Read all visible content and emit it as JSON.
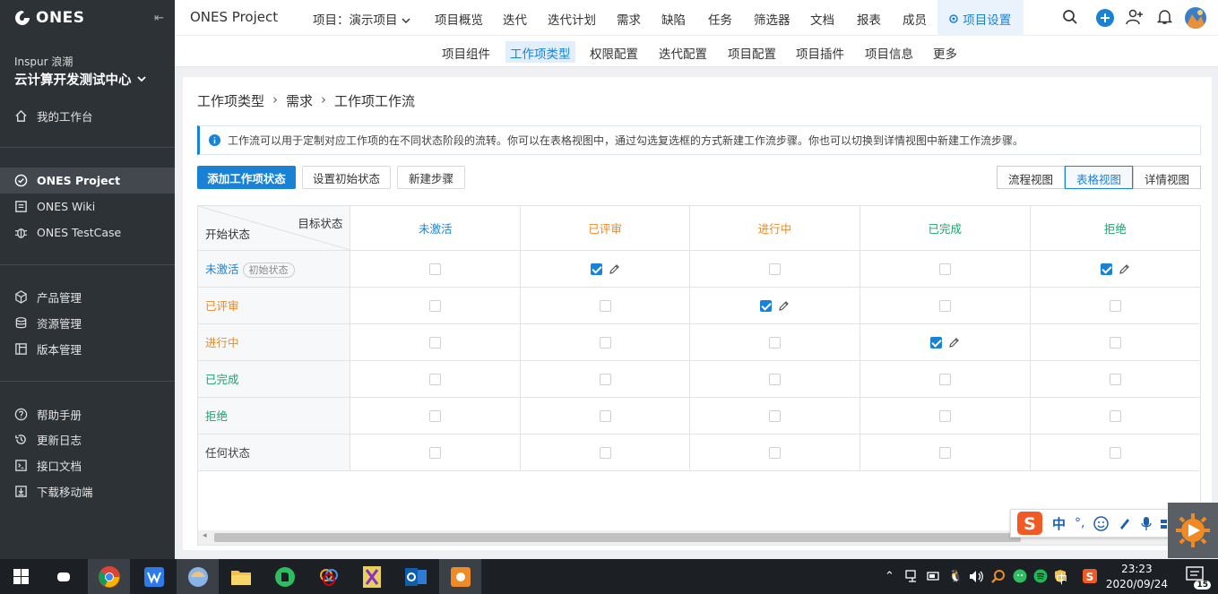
{
  "sidebar": {
    "logo": "ONES",
    "org": "Inspur 浪潮",
    "team": "云计算开发测试中心",
    "items": [
      {
        "label": "我的工作台",
        "icon": "home-icon"
      },
      {
        "label": "ONES Project",
        "icon": "check-circle-icon"
      },
      {
        "label": "ONES Wiki",
        "icon": "document-icon"
      },
      {
        "label": "ONES TestCase",
        "icon": "bug-icon"
      },
      {
        "label": "产品管理",
        "icon": "cube-icon"
      },
      {
        "label": "资源管理",
        "icon": "database-icon"
      },
      {
        "label": "版本管理",
        "icon": "version-icon"
      },
      {
        "label": "帮助手册",
        "icon": "help-icon"
      },
      {
        "label": "更新日志",
        "icon": "history-icon"
      },
      {
        "label": "接口文档",
        "icon": "terminal-icon"
      },
      {
        "label": "下载移动端",
        "icon": "download-icon"
      }
    ]
  },
  "topbar": {
    "project_title": "ONES Project",
    "project_selector": "项目：演示项目",
    "nav": [
      "项目概览",
      "迭代",
      "迭代计划",
      "需求",
      "缺陷",
      "任务",
      "筛选器",
      "文档",
      "报表",
      "成员"
    ],
    "settings": "项目设置"
  },
  "subnav": [
    "项目组件",
    "工作项类型",
    "权限配置",
    "迭代配置",
    "项目配置",
    "项目插件",
    "项目信息",
    "更多"
  ],
  "breadcrumb": [
    "工作项类型",
    "需求",
    "工作项工作流"
  ],
  "info": "工作流可以用于定制对应工作项的在不同状态阶段的流转。你可以在表格视图中，通过勾选复选框的方式新建工作流步骤。你也可以切换到详情视图中新建工作流步骤。",
  "buttons": {
    "add_state": "添加工作项状态",
    "set_initial": "设置初始状态",
    "new_step": "新建步骤"
  },
  "views": [
    "流程视图",
    "表格视图",
    "详情视图"
  ],
  "table": {
    "corner_target": "目标状态",
    "corner_start": "开始状态",
    "initial_tag": "初始状态",
    "columns": [
      {
        "label": "未激活",
        "color": "#1a82d6"
      },
      {
        "label": "已评审",
        "color": "#e88b28"
      },
      {
        "label": "进行中",
        "color": "#e88b28"
      },
      {
        "label": "已完成",
        "color": "#1aa46a"
      },
      {
        "label": "拒绝",
        "color": "#1aa46a"
      }
    ],
    "rows": [
      {
        "label": "未激活",
        "color": "#1a82d6",
        "checked": [
          false,
          true,
          false,
          false,
          true
        ]
      },
      {
        "label": "已评审",
        "color": "#e88b28",
        "checked": [
          false,
          false,
          true,
          false,
          false
        ]
      },
      {
        "label": "进行中",
        "color": "#e88b28",
        "checked": [
          false,
          false,
          false,
          true,
          false
        ]
      },
      {
        "label": "已完成",
        "color": "#1aa46a",
        "checked": [
          false,
          false,
          false,
          false,
          false
        ]
      },
      {
        "label": "拒绝",
        "color": "#1aa46a",
        "checked": [
          false,
          false,
          false,
          false,
          false
        ]
      },
      {
        "label": "任何状态",
        "color": "#444444",
        "checked": [
          false,
          false,
          false,
          false,
          false
        ]
      }
    ]
  },
  "taskbar": {
    "time": "23:23",
    "date": "2020/09/24",
    "ime": "中",
    "notifications": "15"
  },
  "ime_bar": {
    "mode": "中"
  }
}
